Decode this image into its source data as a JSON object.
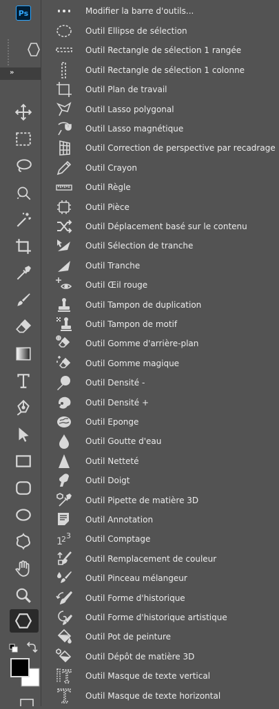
{
  "app": {
    "logo": "Ps"
  },
  "toolbar": {
    "collapse_label": "»",
    "tools": [
      {
        "name": "move-tool",
        "icon": "move-icon"
      },
      {
        "name": "marquee-tool",
        "icon": "marquee-icon"
      },
      {
        "name": "lasso-tool",
        "icon": "lasso-icon"
      },
      {
        "name": "quick-selection-tool",
        "icon": "quick-selection-icon"
      },
      {
        "name": "magic-wand-tool",
        "icon": "magic-wand-icon"
      },
      {
        "name": "crop-tool",
        "icon": "crop-icon"
      },
      {
        "name": "eyedropper-tool",
        "icon": "eyedropper-icon"
      },
      {
        "name": "brush-tool",
        "icon": "brush-icon"
      },
      {
        "name": "eraser-tool",
        "icon": "eraser-icon"
      },
      {
        "name": "gradient-tool",
        "icon": "gradient-icon"
      },
      {
        "name": "type-tool",
        "icon": "type-icon"
      },
      {
        "name": "pen-tool",
        "icon": "pen-icon"
      },
      {
        "name": "path-selection-tool",
        "icon": "arrow-icon"
      },
      {
        "name": "rectangle-tool",
        "icon": "rectangle-icon"
      },
      {
        "name": "rounded-rectangle-tool",
        "icon": "rounded-rectangle-icon"
      },
      {
        "name": "ellipse-tool",
        "icon": "ellipse-icon"
      },
      {
        "name": "custom-shape-tool",
        "icon": "custom-shape-icon"
      },
      {
        "name": "hand-tool",
        "icon": "hand-icon"
      },
      {
        "name": "zoom-tool",
        "icon": "zoom-icon"
      },
      {
        "name": "polygon-tool",
        "icon": "hexagon-icon",
        "active": true
      }
    ],
    "colors": {
      "foreground": "#000000",
      "background": "#ffffff"
    }
  },
  "menu": {
    "header": "Modifier la barre d'outils...",
    "items": [
      {
        "label": "Outil Ellipse de sélection",
        "icon": "ellipse-marquee-icon"
      },
      {
        "label": "Outil Rectangle de sélection 1 rangée",
        "icon": "single-row-marquee-icon"
      },
      {
        "label": "Outil Rectangle de sélection 1 colonne",
        "icon": "single-column-marquee-icon"
      },
      {
        "label": "Outil Plan de travail",
        "icon": "artboard-icon"
      },
      {
        "label": "Outil Lasso polygonal",
        "icon": "polygonal-lasso-icon"
      },
      {
        "label": "Outil Lasso magnétique",
        "icon": "magnetic-lasso-icon"
      },
      {
        "label": "Outil Correction de perspective par recadrage",
        "icon": "perspective-crop-icon"
      },
      {
        "label": "Outil Crayon",
        "icon": "pencil-icon"
      },
      {
        "label": "Outil Règle",
        "icon": "ruler-icon"
      },
      {
        "label": "Outil Pièce",
        "icon": "patch-icon"
      },
      {
        "label": "Outil Déplacement basé sur le contenu",
        "icon": "content-aware-move-icon"
      },
      {
        "label": "Outil Sélection de tranche",
        "icon": "slice-select-icon"
      },
      {
        "label": "Outil Tranche",
        "icon": "slice-icon"
      },
      {
        "label": "Outil Œil rouge",
        "icon": "red-eye-icon"
      },
      {
        "label": "Outil Tampon de duplication",
        "icon": "clone-stamp-icon"
      },
      {
        "label": "Outil Tampon de motif",
        "icon": "pattern-stamp-icon"
      },
      {
        "label": "Outil Gomme d'arrière-plan",
        "icon": "background-eraser-icon"
      },
      {
        "label": "Outil Gomme magique",
        "icon": "magic-eraser-icon"
      },
      {
        "label": "Outil Densité -",
        "icon": "dodge-icon"
      },
      {
        "label": "Outil Densité +",
        "icon": "burn-icon"
      },
      {
        "label": "Outil Eponge",
        "icon": "sponge-icon"
      },
      {
        "label": "Outil Goutte d'eau",
        "icon": "blur-icon"
      },
      {
        "label": "Outil Netteté",
        "icon": "sharpen-icon"
      },
      {
        "label": "Outil Doigt",
        "icon": "smudge-icon"
      },
      {
        "label": "Outil Pipette de matière 3D",
        "icon": "3d-material-eyedropper-icon"
      },
      {
        "label": "Outil Annotation",
        "icon": "note-icon"
      },
      {
        "label": "Outil Comptage",
        "icon": "count-icon"
      },
      {
        "label": "Outil Remplacement de couleur",
        "icon": "color-replacement-icon"
      },
      {
        "label": "Outil Pinceau mélangeur",
        "icon": "mixer-brush-icon"
      },
      {
        "label": "Outil Forme d'historique",
        "icon": "history-brush-icon"
      },
      {
        "label": "Outil Forme d'historique artistique",
        "icon": "art-history-brush-icon"
      },
      {
        "label": "Outil Pot de peinture",
        "icon": "paint-bucket-icon"
      },
      {
        "label": "Outil Dépôt de matière 3D",
        "icon": "3d-material-drop-icon"
      },
      {
        "label": "Outil Masque de texte vertical",
        "icon": "vertical-type-mask-icon"
      },
      {
        "label": "Outil Masque de texte horizontal",
        "icon": "horizontal-type-mask-icon"
      }
    ]
  }
}
